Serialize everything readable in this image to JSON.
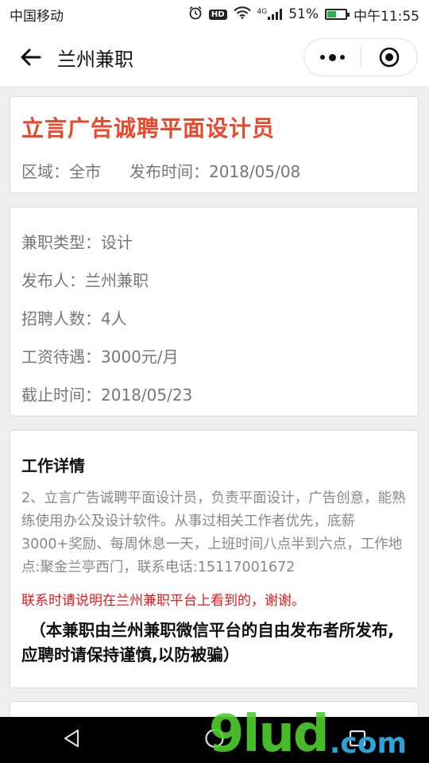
{
  "status_bar": {
    "carrier": "中国移动",
    "hd_badge": "HD",
    "network": "4G",
    "battery_percent": "51%",
    "battery_level": 0.51,
    "time": "中午11:55"
  },
  "nav": {
    "title": "兰州兼职"
  },
  "job": {
    "title": "立言广告诚聘平面设计员",
    "region": "区域：全市",
    "publish_time": "发布时间：2018/05/08"
  },
  "info": {
    "type": "兼职类型：设计",
    "publisher": "发布人：兰州兼职",
    "headcount": "招聘人数：4人",
    "salary": "工资待遇：3000元/月",
    "deadline": "截止时间：2018/05/23"
  },
  "details": {
    "section_title": "工作详情",
    "description": "2、立言广告诚聘平面设计员，负责平面设计，广告创意，能熟练使用办公及设计软件。从事过相关工作者优先，底薪3000+奖励、每周休息一天，上班时间八点半到六点，工作地点:聚金兰亭西门，联系电话:15117001672",
    "contact_notice": "联系时请说明在兰州兼职平台上看到的，谢谢。",
    "disclaimer": "（本兼职由兰州兼职微信平台的自由发布者所发布,应聘时请保持谨慎,以防被骗）"
  },
  "watermark": {
    "brand": "9lud",
    "suffix": ".com"
  },
  "colors": {
    "accent_red": "#e8482b",
    "notice_red": "#e8191d",
    "battery_green": "#2bb24c"
  }
}
